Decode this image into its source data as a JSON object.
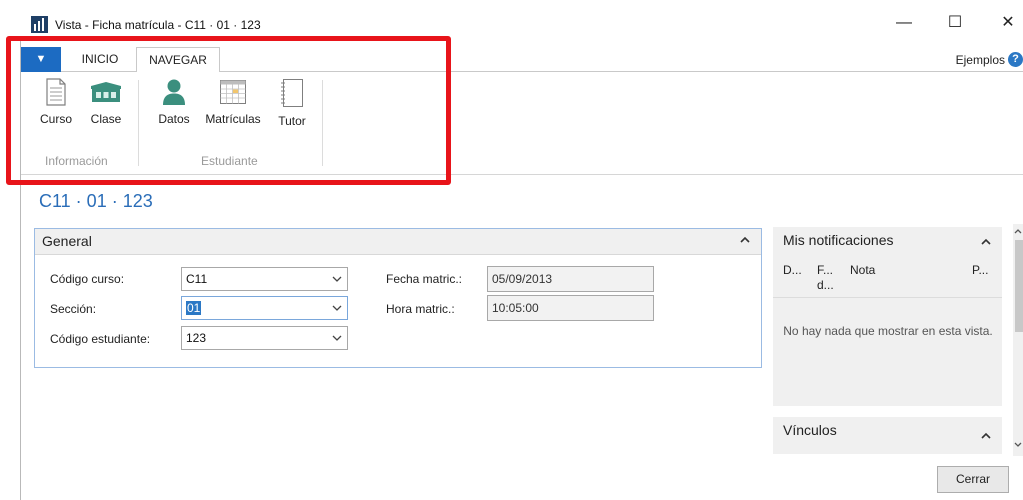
{
  "window": {
    "title": "Vista - Ficha matrícula - C11 · 01 · 123",
    "minimize": "—",
    "maximize": "☐",
    "close": "✕"
  },
  "ribbon": {
    "file_tab": "▼",
    "tabs": [
      {
        "label": "INICIO",
        "active": false
      },
      {
        "label": "NAVEGAR",
        "active": true
      }
    ],
    "help_link": "Ejemplos",
    "help_icon": "?",
    "groups": [
      {
        "label": "Información",
        "buttons": [
          {
            "label": "Curso",
            "icon": "document-icon"
          },
          {
            "label": "Clase",
            "icon": "classroom-icon"
          }
        ]
      },
      {
        "label": "Estudiante",
        "buttons": [
          {
            "label": "Datos",
            "icon": "person-icon"
          },
          {
            "label": "Matrículas",
            "icon": "calendar-grid-icon"
          },
          {
            "label": "Tutor",
            "icon": "notebook-icon"
          }
        ]
      }
    ]
  },
  "page_title": "C11 · 01 · 123",
  "general": {
    "title": "General",
    "fields": {
      "codigo_curso": {
        "label": "Código curso:",
        "value": "C11"
      },
      "seccion": {
        "label": "Sección:",
        "value": "01"
      },
      "codigo_estudiante": {
        "label": "Código estudiante:",
        "value": "123"
      },
      "fecha_matric": {
        "label": "Fecha matric.:",
        "value": "05/09/2013"
      },
      "hora_matric": {
        "label": "Hora matric.:",
        "value": "10:05:00"
      }
    }
  },
  "notifications": {
    "title": "Mis notificaciones",
    "columns": [
      "D...",
      "F...\nd...",
      "Nota",
      "P..."
    ],
    "empty_message": "No hay nada que mostrar en esta vista."
  },
  "links": {
    "title": "Vínculos"
  },
  "footer": {
    "close_label": "Cerrar"
  },
  "colors": {
    "accent": "#1c6bc2",
    "highlight": "#e8141a",
    "title_blue": "#2a6db8"
  }
}
